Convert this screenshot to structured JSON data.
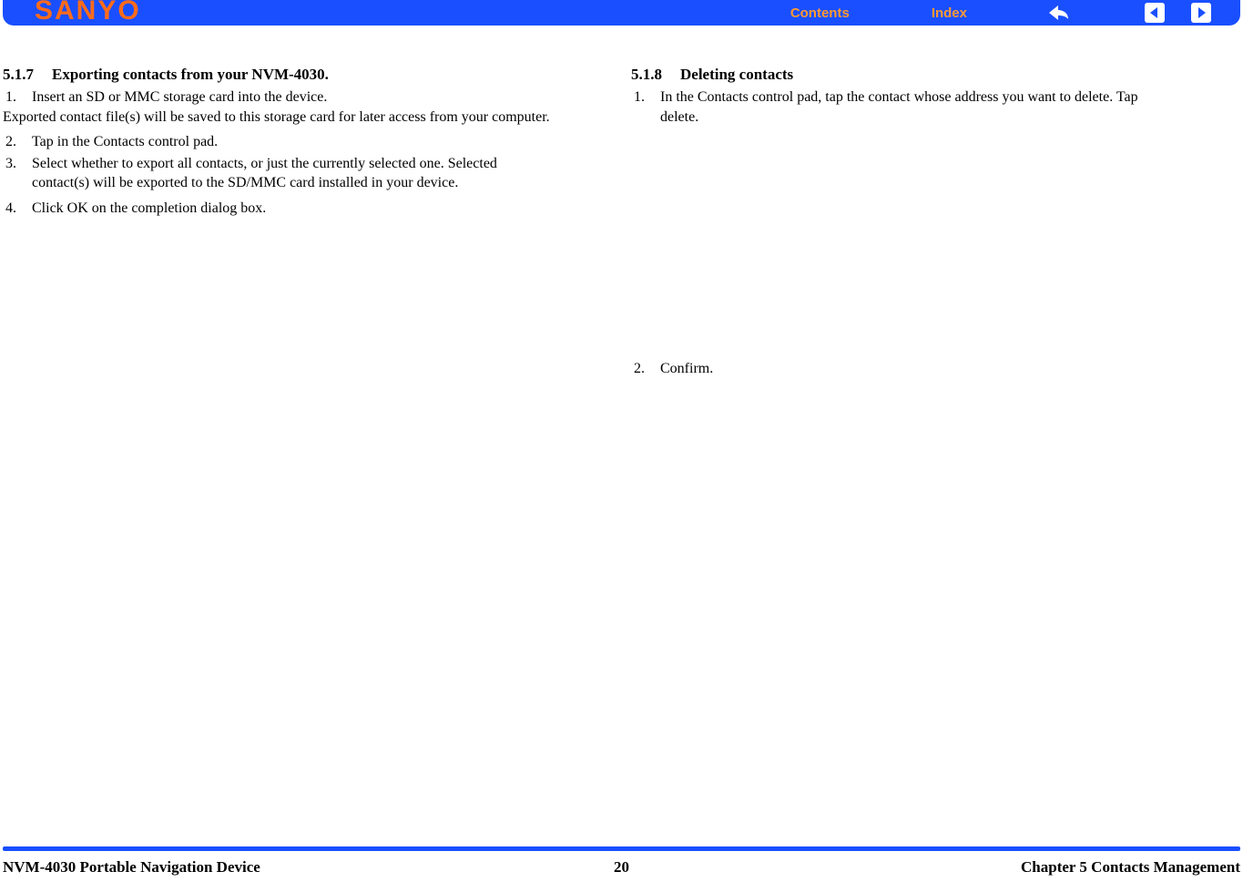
{
  "header": {
    "brand": "SANYO",
    "nav": {
      "contents": "Contents",
      "index": "Index"
    }
  },
  "left": {
    "heading_num": "5.1.7",
    "heading_title": "Exporting contacts from your NVM-4030.",
    "step1_num": "1.",
    "step1": "Insert an SD or MMC storage card into the device.",
    "note": "Exported contact file(s) will be saved to this storage card for later access from your computer.",
    "step2_num": "2.",
    "step2": "Tap   in the Contacts control pad.",
    "step3_num": "3.",
    "step3": "Select whether to export all contacts, or just the currently selected one. Selected contact(s) will be exported to the SD/MMC card installed in your device.",
    "step4_num": "4.",
    "step4": "Click OK on the completion dialog box."
  },
  "right": {
    "heading_num": "5.1.8",
    "heading_title": "Deleting contacts",
    "step1_num": "1.",
    "step1": "In the Contacts control pad, tap the contact whose address you want to delete. Tap delete.",
    "step2_num": "2.",
    "step2": "Confirm."
  },
  "footer": {
    "left": "NVM-4030 Portable Navigation Device",
    "page": "20",
    "right": "Chapter 5 Contacts Management"
  }
}
